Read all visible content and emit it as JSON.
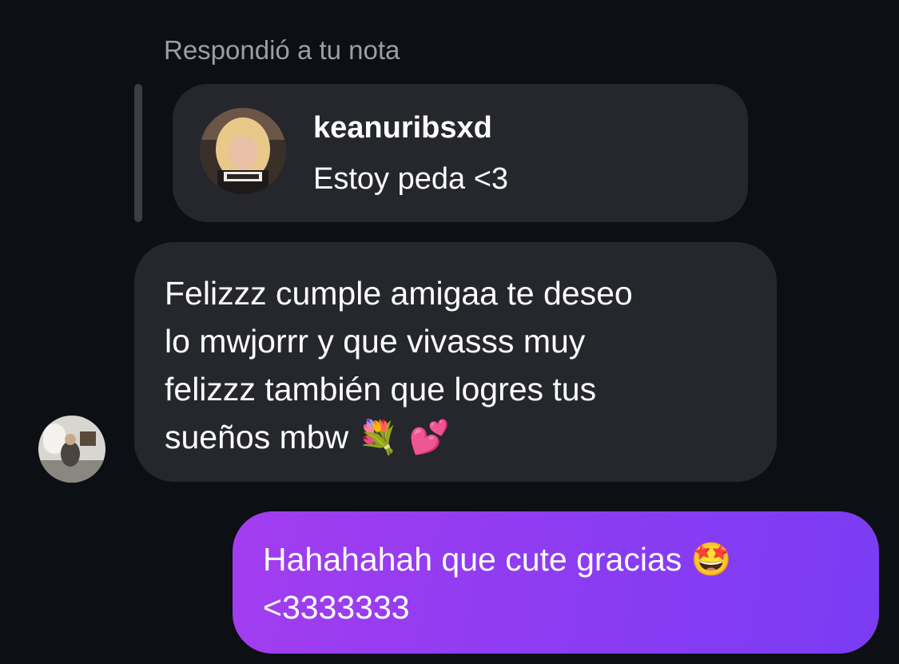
{
  "reply_context": {
    "label": "Respondió a tu nota"
  },
  "note": {
    "username": "keanuribsxd",
    "text": "Estoy peda <3"
  },
  "messages": {
    "incoming": {
      "lines": [
        "Felizzz cumple amigaa te deseo",
        "lo mwjorrr y que vivasss muy",
        "felizzz también que logres tus",
        "sueños mbw"
      ],
      "emoji": "💐 💕"
    },
    "outgoing": {
      "lines": [
        "Hahahahah que cute gracias",
        "<3333333"
      ],
      "emoji": "🤩"
    }
  },
  "colors": {
    "background": "#0c0f13",
    "incoming_bubble": "#25272c",
    "outgoing_bubble_start": "#a33df0",
    "outgoing_bubble_end": "#7a3cf3",
    "muted_text": "#9a9ea6"
  }
}
